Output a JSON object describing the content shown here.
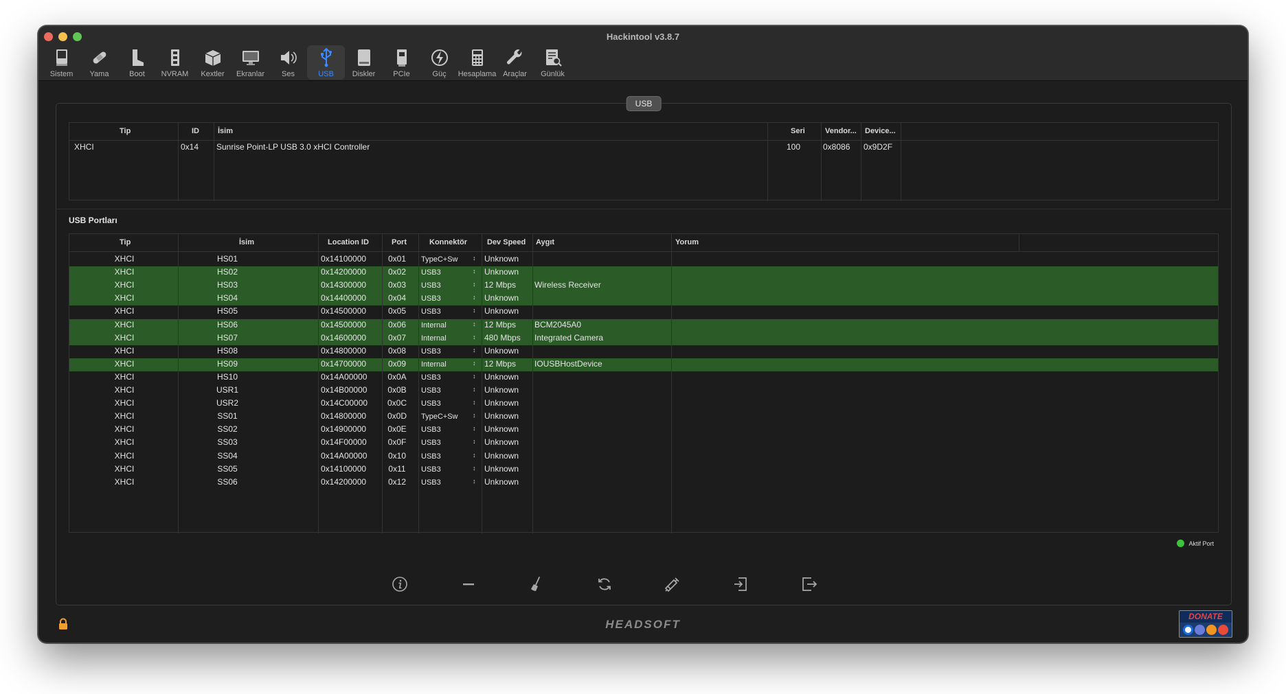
{
  "window": {
    "title": "Hackintool v3.8.7"
  },
  "toolbar": [
    {
      "label": "Sistem",
      "icon": "computer-icon"
    },
    {
      "label": "Yama",
      "icon": "bandage-icon"
    },
    {
      "label": "Boot",
      "icon": "boot-icon"
    },
    {
      "label": "NVRAM",
      "icon": "memory-chip-icon"
    },
    {
      "label": "Kextler",
      "icon": "package-icon"
    },
    {
      "label": "Ekranlar",
      "icon": "display-icon"
    },
    {
      "label": "Ses",
      "icon": "speaker-icon"
    },
    {
      "label": "USB",
      "icon": "usb-icon",
      "active": true
    },
    {
      "label": "Diskler",
      "icon": "disk-icon"
    },
    {
      "label": "PCIe",
      "icon": "pcie-card-icon"
    },
    {
      "label": "Güç",
      "icon": "power-bolt-icon"
    },
    {
      "label": "Hesaplama",
      "icon": "calculator-icon"
    },
    {
      "label": "Araçlar",
      "icon": "wrench-icon"
    },
    {
      "label": "Günlük",
      "icon": "log-search-icon"
    }
  ],
  "group_label": "USB",
  "controllers": {
    "headers": {
      "tip": "Tip",
      "id": "ID",
      "isim": "İsim",
      "seri": "Seri",
      "vendor": "Vendor...",
      "device": "Device..."
    },
    "rows": [
      {
        "tip": "XHCI",
        "id": "0x14",
        "isim": "Sunrise Point-LP USB 3.0 xHCI Controller",
        "seri": "100",
        "vendor": "0x8086",
        "device": "0x9D2F"
      }
    ]
  },
  "ports": {
    "title": "USB Portları",
    "headers": {
      "tip": "Tip",
      "isim": "İsim",
      "location": "Location ID",
      "port": "Port",
      "konnektor": "Konnektör",
      "speed": "Dev Speed",
      "aygit": "Aygıt",
      "yorum": "Yorum"
    },
    "rows": [
      {
        "tip": "XHCI",
        "isim": "HS01",
        "location": "0x14100000",
        "port": "0x01",
        "konnektor": "TypeC+Sw",
        "speed": "Unknown",
        "aygit": "",
        "active": false
      },
      {
        "tip": "XHCI",
        "isim": "HS02",
        "location": "0x14200000",
        "port": "0x02",
        "konnektor": "USB3",
        "speed": "Unknown",
        "aygit": "",
        "active": true
      },
      {
        "tip": "XHCI",
        "isim": "HS03",
        "location": "0x14300000",
        "port": "0x03",
        "konnektor": "USB3",
        "speed": "12 Mbps",
        "aygit": "Wireless Receiver",
        "active": true
      },
      {
        "tip": "XHCI",
        "isim": "HS04",
        "location": "0x14400000",
        "port": "0x04",
        "konnektor": "USB3",
        "speed": "Unknown",
        "aygit": "",
        "active": true
      },
      {
        "tip": "XHCI",
        "isim": "HS05",
        "location": "0x14500000",
        "port": "0x05",
        "konnektor": "USB3",
        "speed": "Unknown",
        "aygit": "",
        "active": false
      },
      {
        "tip": "XHCI",
        "isim": "HS06",
        "location": "0x14500000",
        "port": "0x06",
        "konnektor": "Internal",
        "speed": "12 Mbps",
        "aygit": "BCM2045A0",
        "active": true
      },
      {
        "tip": "XHCI",
        "isim": "HS07",
        "location": "0x14600000",
        "port": "0x07",
        "konnektor": "Internal",
        "speed": "480 Mbps",
        "aygit": "Integrated Camera",
        "active": true
      },
      {
        "tip": "XHCI",
        "isim": "HS08",
        "location": "0x14800000",
        "port": "0x08",
        "konnektor": "USB3",
        "speed": "Unknown",
        "aygit": "",
        "active": false
      },
      {
        "tip": "XHCI",
        "isim": "HS09",
        "location": "0x14700000",
        "port": "0x09",
        "konnektor": "Internal",
        "speed": "12 Mbps",
        "aygit": "IOUSBHostDevice",
        "active": true
      },
      {
        "tip": "XHCI",
        "isim": "HS10",
        "location": "0x14A00000",
        "port": "0x0A",
        "konnektor": "USB3",
        "speed": "Unknown",
        "aygit": "",
        "active": false
      },
      {
        "tip": "XHCI",
        "isim": "USR1",
        "location": "0x14B00000",
        "port": "0x0B",
        "konnektor": "USB3",
        "speed": "Unknown",
        "aygit": "",
        "active": false
      },
      {
        "tip": "XHCI",
        "isim": "USR2",
        "location": "0x14C00000",
        "port": "0x0C",
        "konnektor": "USB3",
        "speed": "Unknown",
        "aygit": "",
        "active": false
      },
      {
        "tip": "XHCI",
        "isim": "SS01",
        "location": "0x14800000",
        "port": "0x0D",
        "konnektor": "TypeC+Sw",
        "speed": "Unknown",
        "aygit": "",
        "active": false
      },
      {
        "tip": "XHCI",
        "isim": "SS02",
        "location": "0x14900000",
        "port": "0x0E",
        "konnektor": "USB3",
        "speed": "Unknown",
        "aygit": "",
        "active": false
      },
      {
        "tip": "XHCI",
        "isim": "SS03",
        "location": "0x14F00000",
        "port": "0x0F",
        "konnektor": "USB3",
        "speed": "Unknown",
        "aygit": "",
        "active": false
      },
      {
        "tip": "XHCI",
        "isim": "SS04",
        "location": "0x14A00000",
        "port": "0x10",
        "konnektor": "USB3",
        "speed": "Unknown",
        "aygit": "",
        "active": false
      },
      {
        "tip": "XHCI",
        "isim": "SS05",
        "location": "0x14100000",
        "port": "0x11",
        "konnektor": "USB3",
        "speed": "Unknown",
        "aygit": "",
        "active": false
      },
      {
        "tip": "XHCI",
        "isim": "SS06",
        "location": "0x14200000",
        "port": "0x12",
        "konnektor": "USB3",
        "speed": "Unknown",
        "aygit": "",
        "active": false
      }
    ]
  },
  "legend": {
    "label": "Aktif Port",
    "color": "#3ec23e"
  },
  "actions": [
    {
      "name": "info-button",
      "icon": "info-icon"
    },
    {
      "name": "remove-button",
      "icon": "minus-icon"
    },
    {
      "name": "clean-button",
      "icon": "broom-icon"
    },
    {
      "name": "refresh-button",
      "icon": "refresh-icon"
    },
    {
      "name": "inject-button",
      "icon": "syringe-icon"
    },
    {
      "name": "import-button",
      "icon": "import-icon"
    },
    {
      "name": "export-button",
      "icon": "export-icon"
    }
  ],
  "footer": {
    "brand": "HEADSOFT",
    "donate": "DONATE"
  },
  "colors": {
    "active_row": "#2b5c28",
    "accent": "#3a8bff"
  }
}
